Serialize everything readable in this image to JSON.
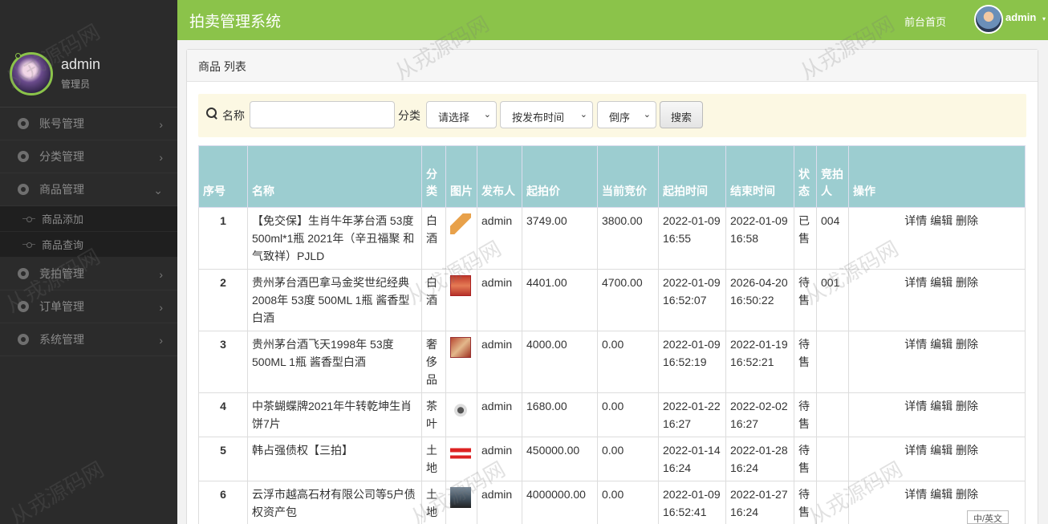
{
  "sidebar": {
    "user": {
      "name": "admin",
      "role": "管理员"
    },
    "menu": [
      {
        "label": "账号管理",
        "chevron": "›"
      },
      {
        "label": "分类管理",
        "chevron": "›"
      },
      {
        "label": "商品管理",
        "chevron": "⌄"
      },
      {
        "label": "竞拍管理",
        "chevron": "›"
      },
      {
        "label": "订单管理",
        "chevron": "›"
      },
      {
        "label": "系统管理",
        "chevron": "›"
      }
    ],
    "submenu": [
      {
        "label": "商品添加"
      },
      {
        "label": "商品查询"
      }
    ]
  },
  "header": {
    "title": "拍卖管理系统",
    "front_link": "前台首页",
    "user": "admin",
    "caret": "▾"
  },
  "panel": {
    "title": "商品 列表"
  },
  "search": {
    "name_label": "名称",
    "name_value": "",
    "category_label": "分类",
    "category_select": "请选择",
    "sort_select": "按发布时间",
    "order_select": "倒序",
    "search_button": "搜索"
  },
  "table": {
    "headers": [
      "序号",
      "名称",
      "分类",
      "图片",
      "发布人",
      "起拍价",
      "当前竞价",
      "起拍时间",
      "结束时间",
      "状态",
      "竞拍人",
      "操作"
    ],
    "rows": [
      {
        "no": "1",
        "name": "【免交保】生肖牛年茅台酒 53度 500ml*1瓶 2021年（辛丑福聚 和气致祥）PJLD",
        "category": "白酒",
        "thumb": "t1",
        "publisher": "admin",
        "start_price": "3749.00",
        "current_bid": "3800.00",
        "start_time": "2022-01-09 16:55",
        "end_time": "2022-01-09 16:58",
        "status": "已售",
        "bidder": "004"
      },
      {
        "no": "2",
        "name": "贵州茅台酒巴拿马金奖世纪经典2008年 53度 500ML 1瓶 酱香型白酒",
        "category": "白酒",
        "thumb": "t2",
        "publisher": "admin",
        "start_price": "4401.00",
        "current_bid": "4700.00",
        "start_time": "2022-01-09 16:52:07",
        "end_time": "2026-04-20 16:50:22",
        "status": "待售",
        "bidder": "001"
      },
      {
        "no": "3",
        "name": "贵州茅台酒飞天1998年 53度 500ML 1瓶 酱香型白酒",
        "category": "奢侈品",
        "thumb": "t3",
        "publisher": "admin",
        "start_price": "4000.00",
        "current_bid": "0.00",
        "start_time": "2022-01-09 16:52:19",
        "end_time": "2022-01-19 16:52:21",
        "status": "待售",
        "bidder": ""
      },
      {
        "no": "4",
        "name": "中茶蝴蝶牌2021年牛转乾坤生肖饼7片",
        "category": "茶叶",
        "thumb": "t4",
        "publisher": "admin",
        "start_price": "1680.00",
        "current_bid": "0.00",
        "start_time": "2022-01-22 16:27",
        "end_time": "2022-02-02 16:27",
        "status": "待售",
        "bidder": ""
      },
      {
        "no": "5",
        "name": "韩占强债权【三拍】",
        "category": "土地",
        "thumb": "t5",
        "publisher": "admin",
        "start_price": "450000.00",
        "current_bid": "0.00",
        "start_time": "2022-01-14 16:24",
        "end_time": "2022-01-28 16:24",
        "status": "待售",
        "bidder": ""
      },
      {
        "no": "6",
        "name": "云浮市越高石材有限公司等5户债权资产包",
        "category": "土地",
        "thumb": "t6",
        "publisher": "admin",
        "start_price": "4000000.00",
        "current_bid": "0.00",
        "start_time": "2022-01-09 16:52:41",
        "end_time": "2022-01-27 16:24",
        "status": "待售",
        "bidder": ""
      }
    ],
    "actions": {
      "detail": "详情",
      "edit": "编辑",
      "delete": "删除"
    }
  },
  "watermark": "从戎源码网",
  "lang_toggle": "中/英文"
}
